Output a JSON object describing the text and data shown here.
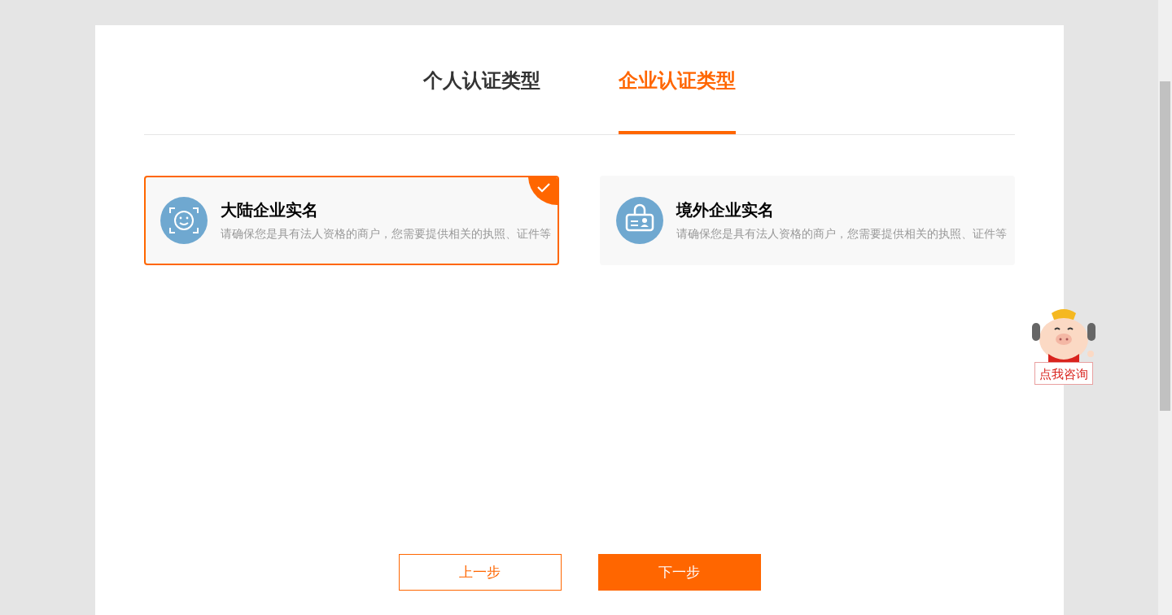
{
  "tabs": [
    {
      "label": "个人认证类型",
      "selected": false
    },
    {
      "label": "企业认证类型",
      "selected": true
    }
  ],
  "options": [
    {
      "title": "大陆企业实名",
      "description": "请确保您是具有法人资格的商户，您需要提供相关的执照、证件等",
      "kind": "face",
      "selected": true
    },
    {
      "title": "境外企业实名",
      "description": "请确保您是具有法人资格的商户，您需要提供相关的执照、证件等",
      "kind": "badge",
      "selected": false
    }
  ],
  "buttons": [
    {
      "label": "上一步",
      "kind": "secondary"
    },
    {
      "label": "下一步",
      "kind": "primary"
    }
  ],
  "consult": {
    "label": "点我咨询"
  }
}
